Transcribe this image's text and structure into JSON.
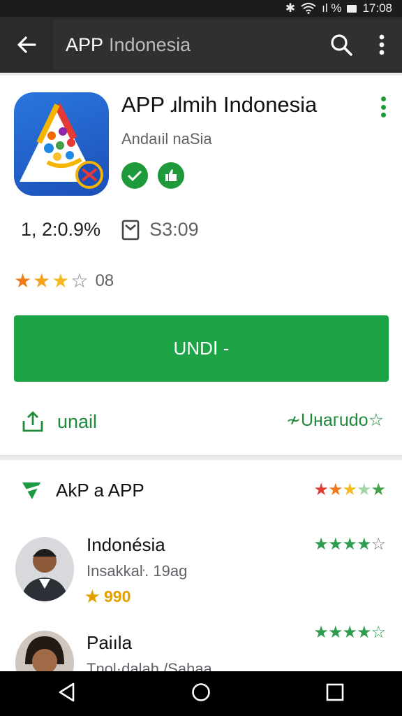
{
  "status_bar": {
    "icons": [
      "bluetooth-icon",
      "wifi-icon",
      "signal-icon",
      "battery-icon"
    ],
    "signal_text": "ıl %",
    "time": "17:08"
  },
  "app_bar": {
    "search_text": "APP",
    "search_text_suffix": "Indonesia"
  },
  "app": {
    "name": "APP ɹlmih Indonesia",
    "developer": "Andaıil naSia",
    "downloads": "1, 2:0.9%",
    "size": "S3:09",
    "rating_stars": 3,
    "rating_count": "08",
    "install_label": "UNDꓲ -",
    "share_label": "unail",
    "wishlist_label": "≁Uнaгudo☆"
  },
  "reviews_section": {
    "title": "AkP a APP",
    "overall_stars": 3.5,
    "items": [
      {
        "name": "Indonésia",
        "subtitle": "Insakkaŀ. 19ag",
        "score": "990",
        "stars": 3.5
      },
      {
        "name": "Paiıla",
        "subtitle": "Tnol·dalah /Sahaa",
        "stars": 3.5
      }
    ]
  },
  "colors": {
    "accent": "#1ea446",
    "appbar": "#2a2a2a",
    "statusbar": "#1c1c1c",
    "star_orange": "#f39c12",
    "star_green": "#2e9d4e",
    "star_red": "#e53935"
  }
}
